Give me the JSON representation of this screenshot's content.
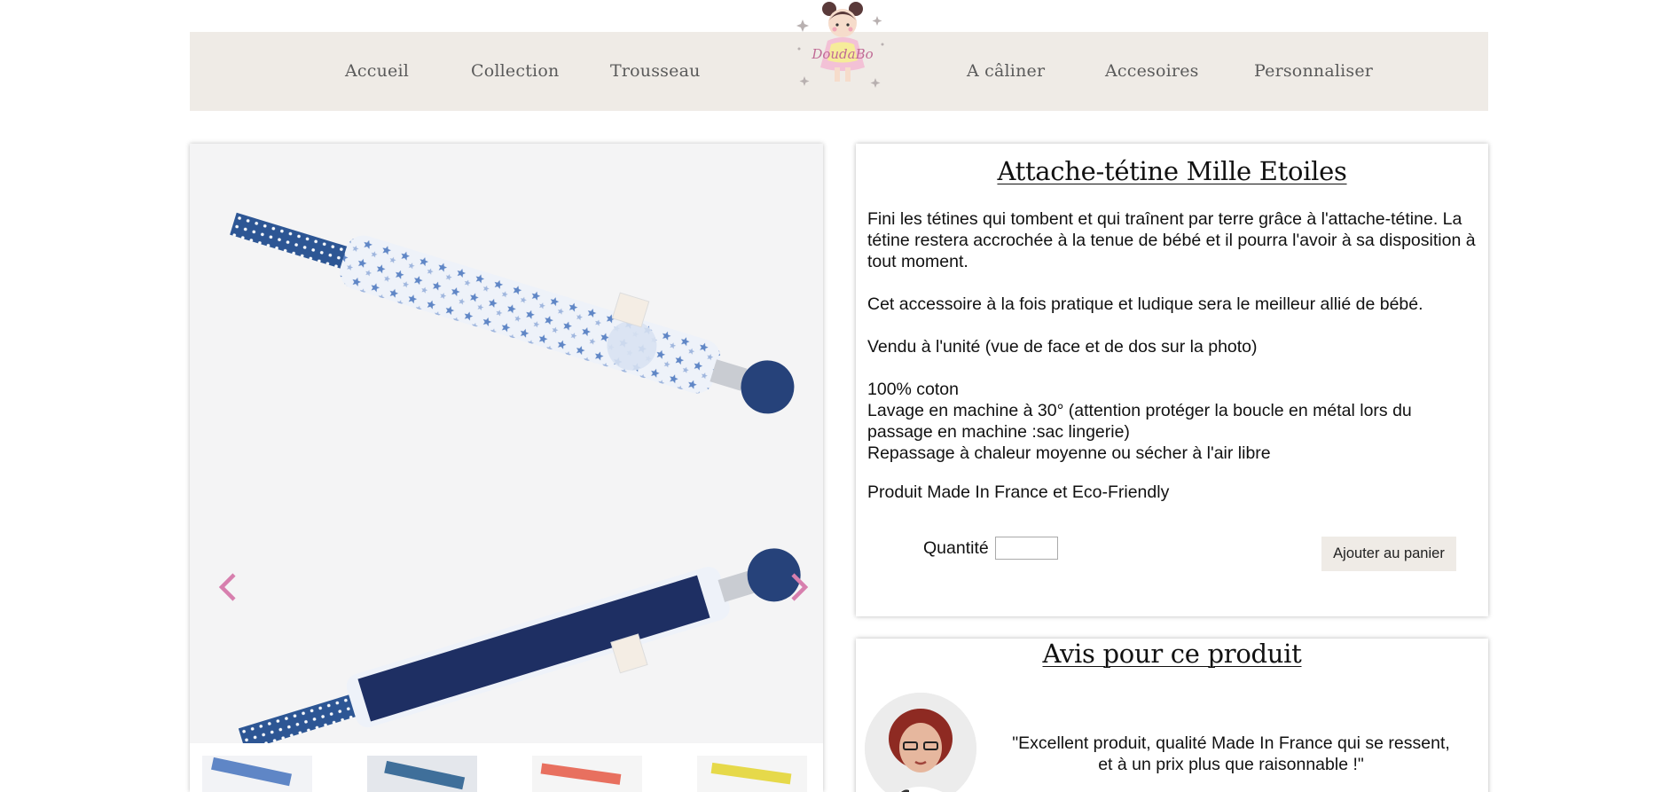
{
  "nav": {
    "items": [
      {
        "label": "Accueil"
      },
      {
        "label": "Collection"
      },
      {
        "label": "Trousseau"
      },
      {
        "label": "A câliner"
      },
      {
        "label": "Accesoires"
      },
      {
        "label": "Personnaliser"
      }
    ],
    "logo_text": "DoudaBo"
  },
  "product": {
    "title": "Attache-tétine Mille Etoiles",
    "description": [
      "Fini les tétines qui tombent et qui traînent par terre grâce à l'attache-tétine. La tétine restera accrochée à la tenue de bébé et il pourra l'avoir à sa disposition à tout moment.",
      "Cet accessoire à la fois pratique et ludique sera le meilleur allié de bébé.",
      "Vendu à l'unité (vue de face et de dos sur la photo)",
      "100% coton",
      "Lavage en machine à 30° (attention protéger la boucle en métal lors du passage en machine :sac lingerie)",
      "Repassage à chaleur moyenne ou sécher à l'air libre",
      "Produit Made In France et Eco-Friendly"
    ],
    "quantity_label": "Quantité",
    "quantity_value": "",
    "add_to_cart_label": "Ajouter au panier"
  },
  "gallery": {
    "prev_icon": "chevron-left-icon",
    "next_icon": "chevron-right-icon",
    "thumbnail_count": 4
  },
  "reviews": {
    "title": "Avis pour ce produit",
    "items": [
      {
        "quote_line1": "\"Excellent produit, qualité Made In France qui se ressent,",
        "quote_line2": "et à un prix plus que raisonnable !\""
      }
    ]
  },
  "colors": {
    "nav_background": "#efebe6",
    "arrow_pink": "#d77fae",
    "button_background": "#efebe6"
  }
}
